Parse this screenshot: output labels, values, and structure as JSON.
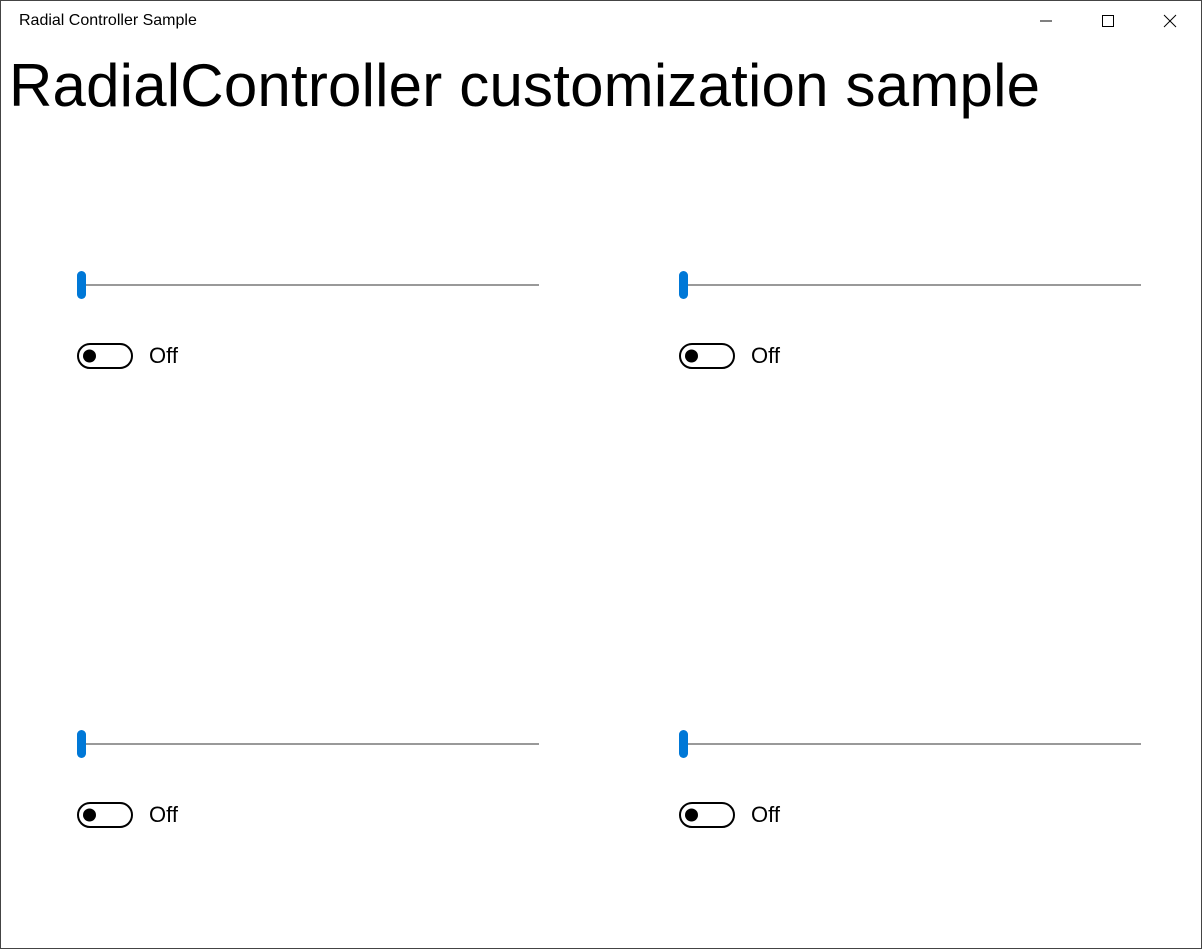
{
  "window": {
    "title": "Radial Controller Sample"
  },
  "header": {
    "title": "RadialController customization sample"
  },
  "cells": [
    {
      "slider_value": 0,
      "toggle_state": "Off"
    },
    {
      "slider_value": 0,
      "toggle_state": "Off"
    },
    {
      "slider_value": 0,
      "toggle_state": "Off"
    },
    {
      "slider_value": 0,
      "toggle_state": "Off"
    }
  ],
  "colors": {
    "accent": "#0078D7"
  }
}
